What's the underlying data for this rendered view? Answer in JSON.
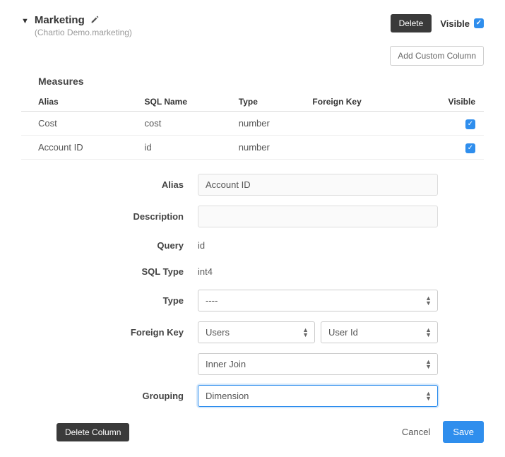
{
  "header": {
    "title": "Marketing",
    "subtitle": "(Chartio Demo.marketing)",
    "delete_label": "Delete",
    "visible_label": "Visible",
    "add_custom_label": "Add Custom Column"
  },
  "section_title": "Measures",
  "table": {
    "headers": {
      "alias": "Alias",
      "sql_name": "SQL Name",
      "type": "Type",
      "foreign_key": "Foreign Key",
      "visible": "Visible"
    },
    "rows": [
      {
        "alias": "Cost",
        "sql_name": "cost",
        "type": "number",
        "foreign_key": ""
      },
      {
        "alias": "Account ID",
        "sql_name": "id",
        "type": "number",
        "foreign_key": ""
      }
    ]
  },
  "form": {
    "labels": {
      "alias": "Alias",
      "description": "Description",
      "query": "Query",
      "sql_type": "SQL Type",
      "type": "Type",
      "foreign_key": "Foreign Key",
      "grouping": "Grouping"
    },
    "values": {
      "alias": "Account ID",
      "description": "",
      "query": "id",
      "sql_type": "int4",
      "type": "----",
      "fk_table": "Users",
      "fk_column": "User Id",
      "join": "Inner Join",
      "grouping": "Dimension"
    }
  },
  "footer": {
    "delete_col": "Delete Column",
    "cancel": "Cancel",
    "save": "Save"
  }
}
